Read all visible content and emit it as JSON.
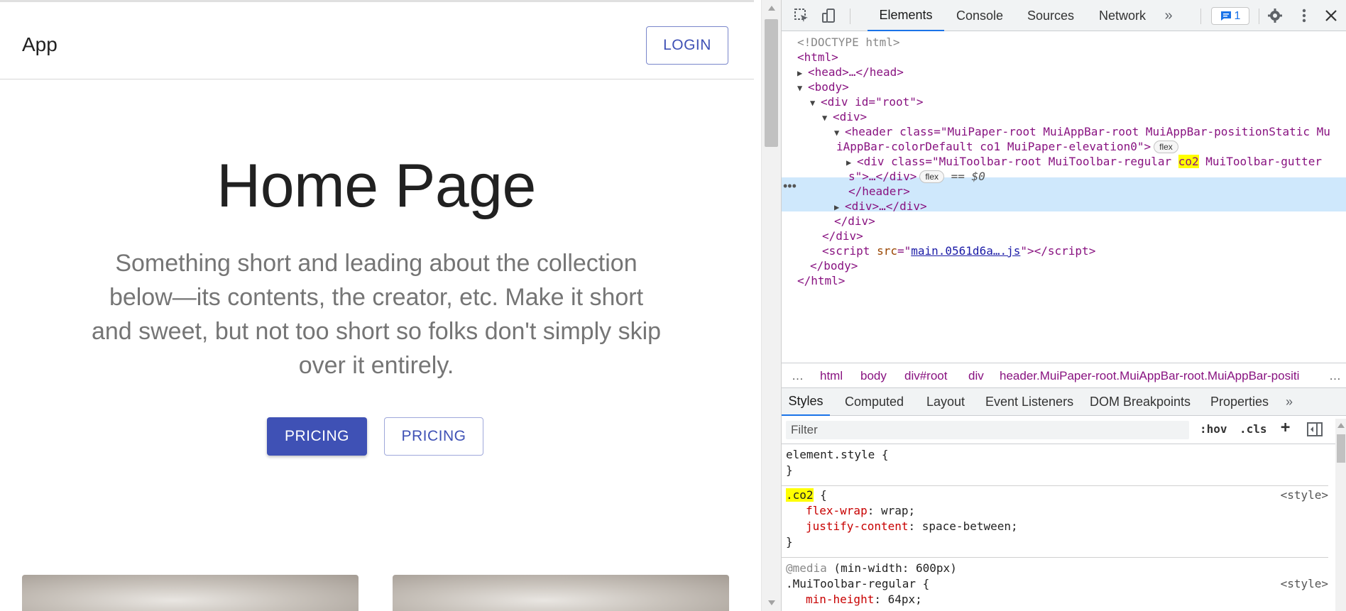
{
  "page": {
    "app_title": "App",
    "login_label": "LOGIN",
    "hero_title": "Home Page",
    "hero_subtitle": "Something short and leading about the collection below—its contents, the creator, etc. Make it short and sweet, but not too short so folks don't simply skip over it entirely.",
    "primary_button": "PRICING",
    "secondary_button": "PRICING"
  },
  "devtools": {
    "tabs": [
      "Elements",
      "Console",
      "Sources",
      "Network"
    ],
    "more_tabs": "»",
    "issues_count": "1",
    "dom": {
      "doctype": "<!DOCTYPE html>",
      "html_open": "<html>",
      "head": "<head>…</head>",
      "body_open": "<body>",
      "root_div": "<div id=\"root\">",
      "div_open": "<div>",
      "header_line1": "<header class=\"MuiPaper-root MuiAppBar-root MuiAppBar-positionStatic Mu",
      "header_line2": "iAppBar-colorDefault co1 MuiPaper-elevation0\">",
      "toolbar_line1_a": "<div class=\"MuiToolbar-root MuiToolbar-regular ",
      "toolbar_line1_hl": "co2",
      "toolbar_line1_b": " MuiToolbar-gutter",
      "toolbar_line2": "s\">…</div>",
      "selected_marker": "== $0",
      "header_close": "</header>",
      "div_collapsed": "<div>…</div>",
      "div_close": "</div>",
      "script_src": "main.0561d6a….js",
      "body_close": "</body>",
      "html_close": "</html>",
      "flex_badge": "flex"
    },
    "breadcrumbs": [
      "html",
      "body",
      "div#root",
      "div",
      "header.MuiPaper-root.MuiAppBar-root.MuiAppBar-positi"
    ],
    "pane_tabs": [
      "Styles",
      "Computed",
      "Layout",
      "Event Listeners",
      "DOM Breakpoints",
      "Properties"
    ],
    "filter_placeholder": "Filter",
    "hov": ":hov",
    "cls": ".cls",
    "styles": {
      "element_style": "element.style {",
      "close_brace": "}",
      "co2_selector": ".co2",
      "co2_open": " {",
      "source": "<style>",
      "prop1_name": "flex-wrap",
      "prop1_value": ": wrap;",
      "prop2_name": "justify-content",
      "prop2_value": ": space-between;",
      "media_kw": "@media",
      "media_query": " (min-width: 600px)",
      "toolbar_selector": ".MuiToolbar-regular {",
      "prop3_name": "min-height",
      "prop3_value": ": 64px;"
    },
    "colors": {
      "highlight": "#ffff00",
      "selected_row": "#cfe8fc",
      "accent": "#1a73e8",
      "brand": "#3f51b5"
    }
  }
}
